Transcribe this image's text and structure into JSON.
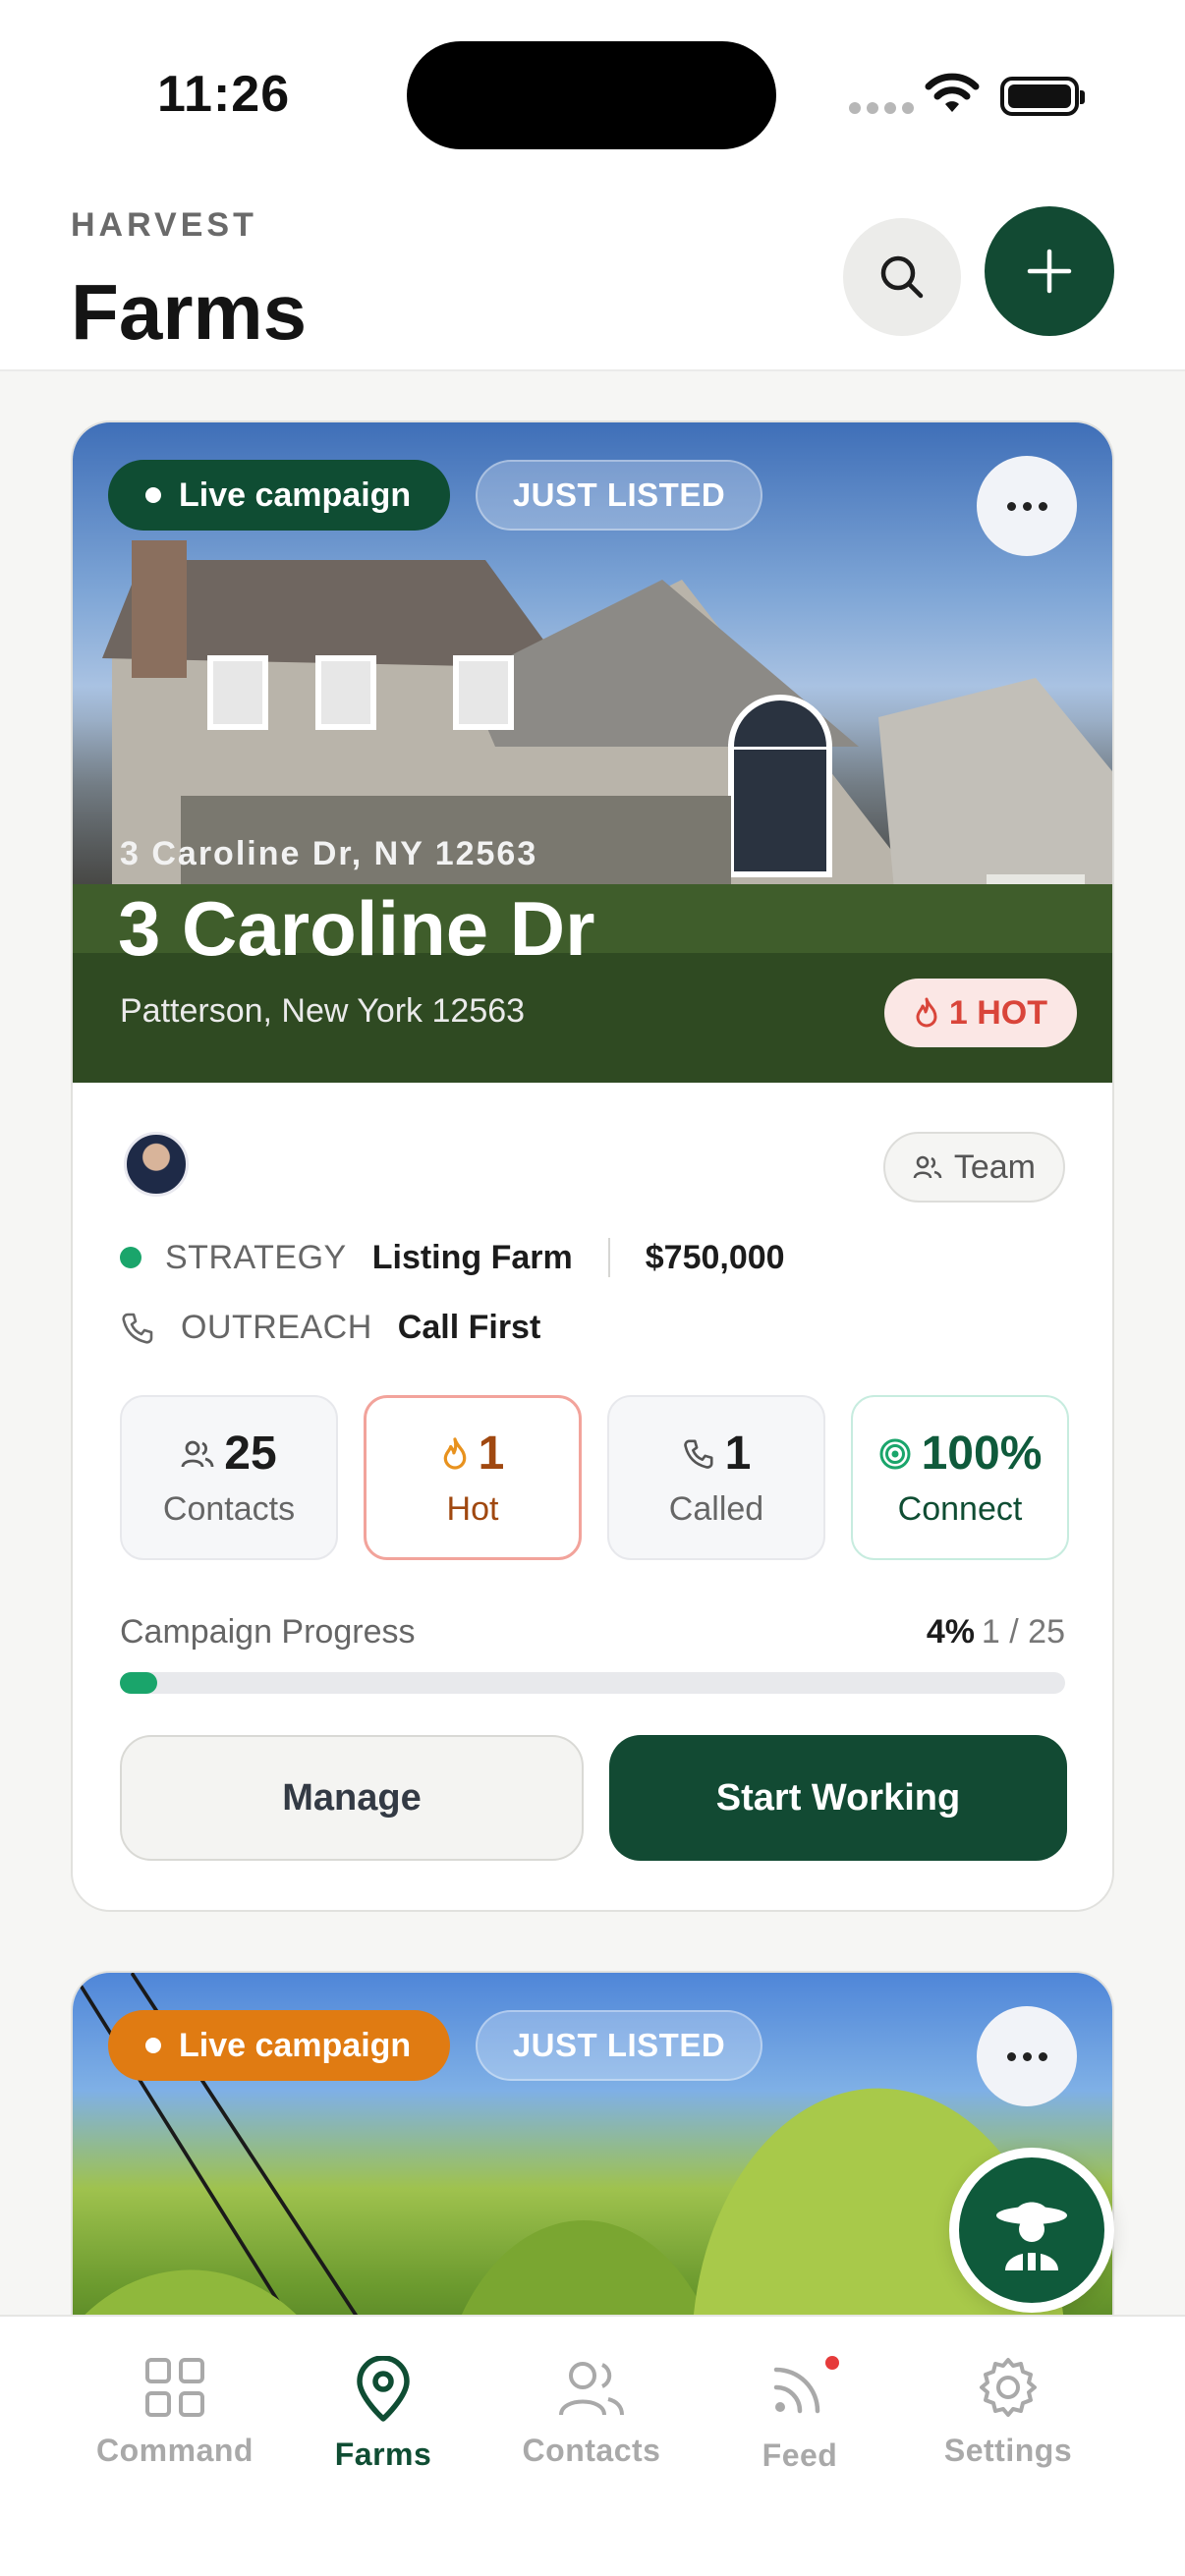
{
  "status_bar": {
    "time": "11:26"
  },
  "header": {
    "eyebrow": "HARVEST",
    "title": "Farms"
  },
  "cards": [
    {
      "status_label": "Live campaign",
      "status_color": "#0f4d33",
      "tag_label": "JUST LISTED",
      "address_line": "3 Caroline Dr, NY 12563",
      "title": "3 Caroline Dr",
      "city": "Patterson, New York 12563",
      "hot_badge": "1 HOT",
      "team_label": "Team",
      "strategy_label": "STRATEGY",
      "strategy_value": "Listing Farm",
      "price": "$750,000",
      "outreach_label": "OUTREACH",
      "outreach_value": "Call First",
      "stats": {
        "contacts": {
          "value": "25",
          "label": "Contacts"
        },
        "hot": {
          "value": "1",
          "label": "Hot"
        },
        "called": {
          "value": "1",
          "label": "Called"
        },
        "connect": {
          "value": "100%",
          "label": "Connect"
        }
      },
      "progress": {
        "label": "Campaign Progress",
        "percent_text": "4%",
        "count_text": "1 / 25",
        "fraction": 0.04
      },
      "manage_label": "Manage",
      "start_label": "Start Working"
    },
    {
      "status_label": "Live campaign",
      "status_color": "#e07b12",
      "tag_label": "JUST LISTED"
    }
  ],
  "tabs": [
    {
      "label": "Command",
      "icon": "grid-icon"
    },
    {
      "label": "Farms",
      "icon": "map-pin-icon",
      "active": true
    },
    {
      "label": "Contacts",
      "icon": "users-icon"
    },
    {
      "label": "Feed",
      "icon": "rss-icon"
    },
    {
      "label": "Settings",
      "icon": "gear-icon"
    }
  ],
  "colors": {
    "brand": "#124a33",
    "accent_green": "#1aa56b",
    "hot_red": "#d9453a"
  }
}
